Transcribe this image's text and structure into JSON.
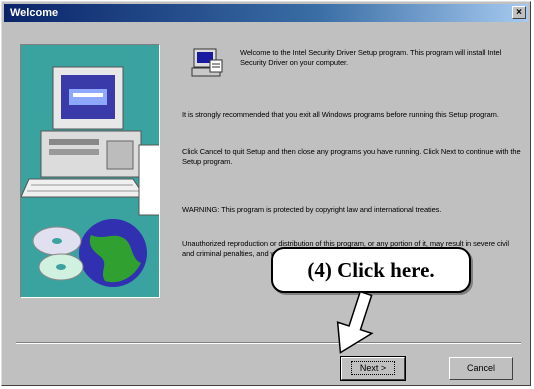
{
  "window": {
    "title": "Welcome",
    "close_label": "×"
  },
  "content": {
    "paragraph1": "Welcome to the Intel Security Driver Setup program. This program will install Intel Security Driver on your computer.",
    "paragraph2": "It is strongly recommended that you exit all Windows programs before running this Setup program.",
    "paragraph3": "Click Cancel to quit Setup and then close any programs you have running.  Click Next to continue with the Setup program.",
    "paragraph4": "WARNING: This program is protected by copyright law and international treaties.",
    "paragraph5": "Unauthorized reproduction or distribution of this program, or any portion of it, may result in severe civil and criminal penalties, and will be prosecuted to the maximum extent possible under law."
  },
  "buttons": {
    "next_label": "Next >",
    "cancel_label": "Cancel"
  },
  "annotation": {
    "callout_text": "(4)  Click here."
  },
  "colors": {
    "title_bar": "#0a246a",
    "dialog_bg": "#c0c0c0",
    "side_panel": "#3aa3a0"
  }
}
